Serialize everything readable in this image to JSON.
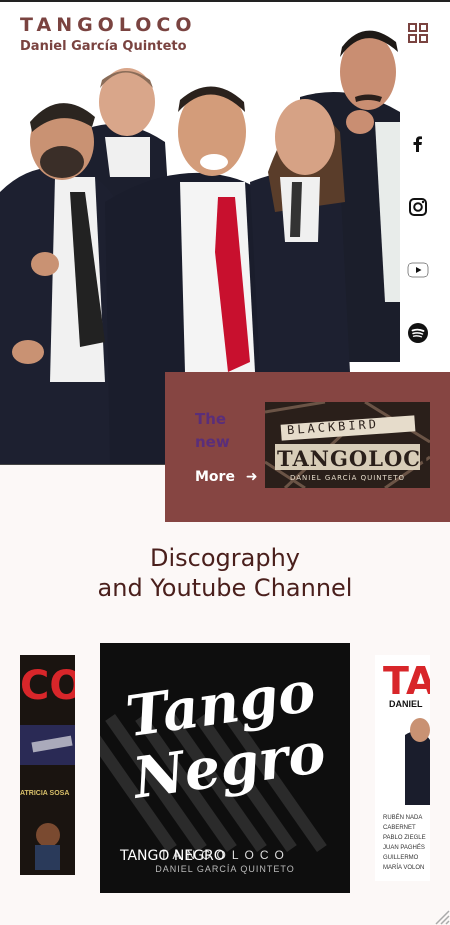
{
  "brand": {
    "title": "TANGOLOCO",
    "subtitle": "Daniel García Quinteto"
  },
  "icons": {
    "menu": "grid-menu-icon",
    "social": [
      "facebook-icon",
      "instagram-icon",
      "youtube-icon",
      "spotify-icon"
    ]
  },
  "promo": {
    "line1": "The",
    "line2": "new",
    "more": "More",
    "cover_title": "BLACKBIRD",
    "cover_band": "TANGOLOCO",
    "cover_sub": "DANIEL GARCÍA QUINTETO"
  },
  "discography": {
    "title_line1": "Discography",
    "title_line2": "and Youtube Channel",
    "left_album_text": "CO",
    "left_album_caption": "ATRICIA SOSA",
    "center_album_art": "Tango Negro",
    "center_album_band": "TANGOLOCO",
    "center_album_sub": "DANIEL GARCÍA QUINTETO",
    "center_album_label": "TANGO NEGRO",
    "right_album_text": "TA",
    "right_album_sub": "DANIEL",
    "right_album_credits": [
      "RUBÉN NADA",
      "CABERNET",
      "PABLO ZIEGLE",
      "JUAN PAGHÉS",
      "GUILLERMO",
      "MARÍA VOLON"
    ]
  },
  "colors": {
    "brand": "#7a4340",
    "promo_bg": "#864542",
    "heading": "#4a1f1c",
    "page_bg": "#fcf8f7"
  }
}
